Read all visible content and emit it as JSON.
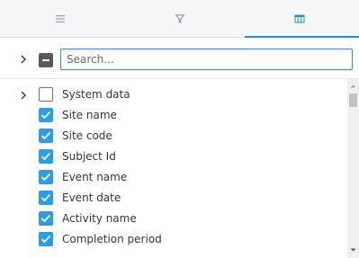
{
  "tabs": [
    {
      "icon": "menu-icon",
      "active": false
    },
    {
      "icon": "filter-icon",
      "active": false
    },
    {
      "icon": "columns-icon",
      "active": true
    }
  ],
  "search": {
    "placeholder": "Search...",
    "value": ""
  },
  "accent_color": "#2b8ad6",
  "checkbox_color": "#2b9de8",
  "items": [
    {
      "label": "System data",
      "checked": false,
      "expandable": true
    },
    {
      "label": "Site name",
      "checked": true,
      "expandable": false
    },
    {
      "label": "Site code",
      "checked": true,
      "expandable": false
    },
    {
      "label": "Subject Id",
      "checked": true,
      "expandable": false
    },
    {
      "label": "Event name",
      "checked": true,
      "expandable": false
    },
    {
      "label": "Event date",
      "checked": true,
      "expandable": false
    },
    {
      "label": "Activity name",
      "checked": true,
      "expandable": false
    },
    {
      "label": "Completion period",
      "checked": true,
      "expandable": false
    }
  ]
}
